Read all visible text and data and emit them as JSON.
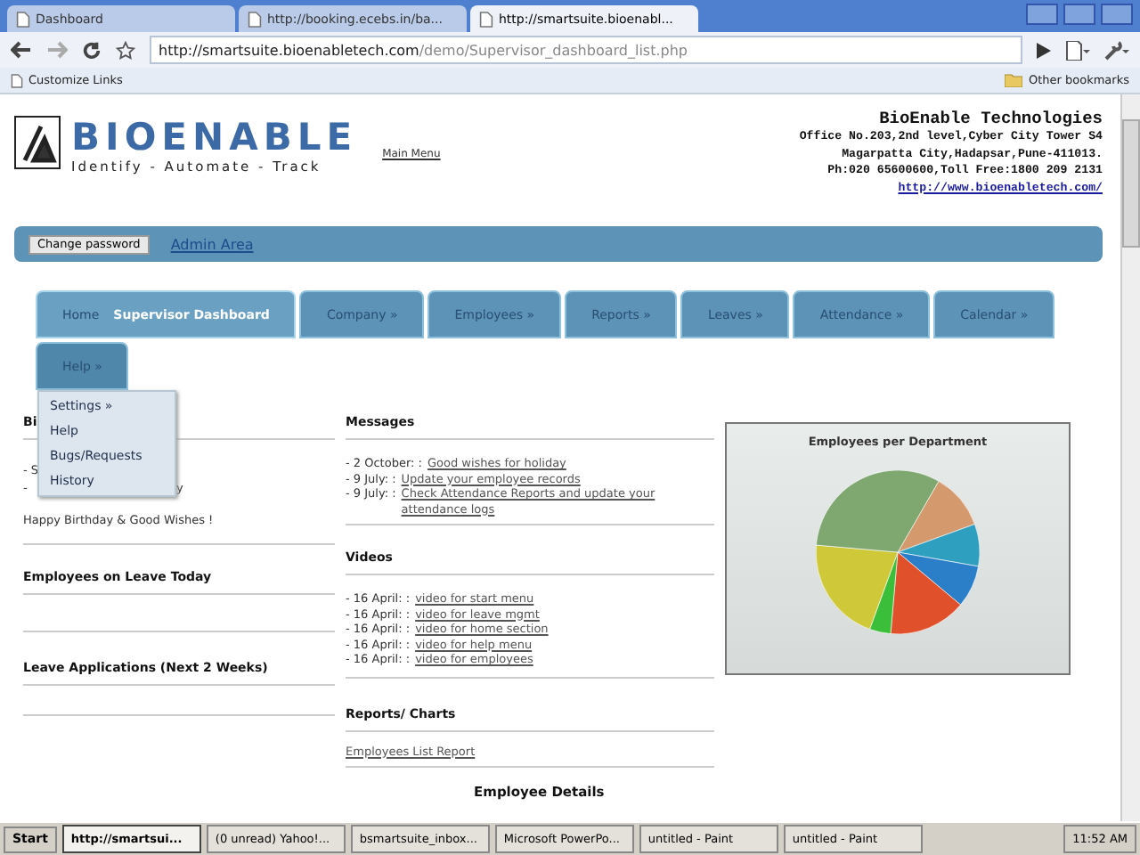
{
  "browser": {
    "tabs": [
      {
        "label": "Dashboard",
        "selected": false
      },
      {
        "label": "http://booking.ecebs.in/ba...",
        "selected": false
      },
      {
        "label": "http://smartsuite.bioenabl...",
        "selected": true
      }
    ],
    "address": {
      "host": "http://smartsuite.bioenabletech.com",
      "path": "/demo/Supervisor_dashboard_list.php"
    },
    "bookmarks": [
      {
        "label": "Customize Links"
      }
    ],
    "other_bookmarks": "Other bookmarks"
  },
  "header": {
    "brand": "BIOENABLE",
    "tagline": "Identify - Automate - Track",
    "main_menu": "Main Menu",
    "company": "BioEnable Technologies",
    "address_lines": [
      "Office No.203,2nd level,Cyber City Tower S4",
      "Magarpatta City,Hadapsar,Pune-411013.",
      "Ph:020 65600600,Toll Free:1800 209 2131"
    ],
    "website": "http://www.bioenabletech.com/"
  },
  "admin_bar": {
    "button": "Change password",
    "title": "Admin Area"
  },
  "nav": {
    "tabs": [
      {
        "label": "Home",
        "current": "Supervisor Dashboard",
        "selected": true
      },
      {
        "label": "Company »",
        "selected": false
      },
      {
        "label": "Employees »",
        "selected": false
      },
      {
        "label": "Reports »",
        "selected": false
      },
      {
        "label": "Leaves »",
        "selected": false
      },
      {
        "label": "Attendance »",
        "selected": false
      },
      {
        "label": "Calendar »",
        "selected": false
      },
      {
        "label": "Help »",
        "selected": false,
        "expanded": true
      }
    ],
    "menu": [
      "Settings »",
      "Help",
      "Bugs/Requests",
      "History"
    ]
  },
  "birthdays": {
    "title": "Bi",
    "lines": [
      {
        "start": "- S"
      },
      {
        "start": "-",
        "end": "y"
      }
    ],
    "wish": "Happy Birthday & Good Wishes !"
  },
  "messages": {
    "title": "Messages",
    "items": [
      {
        "date": "- 2 October: :",
        "link": "Good wishes for holiday"
      },
      {
        "date": "- 9 July: :",
        "link": "Update your employee records"
      },
      {
        "date": "- 9 July: :",
        "link": "Check Attendance Reports and update your attendance logs"
      }
    ]
  },
  "leave_today": {
    "title": "Employees on Leave Today"
  },
  "videos": {
    "title": "Videos",
    "items": [
      {
        "date": "- 16 April: :",
        "link": "video for start menu"
      },
      {
        "date": "- 16 April: :",
        "link": "video for leave mgmt"
      },
      {
        "date": "- 16 April: :",
        "link": "video for home section"
      },
      {
        "date": "- 16 April: :",
        "link": "video for help menu"
      },
      {
        "date": "- 16 April: :",
        "link": "video for employees"
      }
    ]
  },
  "leave_applications": {
    "title": "Leave Applications (Next 2 Weeks)"
  },
  "reports": {
    "title": "Reports/ Charts",
    "link": "Employees List Report"
  },
  "chart": {
    "title": "Employees per Department"
  },
  "employee_details": {
    "title": "Employee Details"
  },
  "taskbar": {
    "start": "Start",
    "items": [
      {
        "label": "http://smartsui...",
        "selected": true
      },
      {
        "label": "(0 unread) Yahoo!...",
        "selected": false
      },
      {
        "label": "bsmartsuite_inbox...",
        "selected": false
      },
      {
        "label": "Microsoft PowerPo...",
        "selected": false
      },
      {
        "label": "untitled - Paint",
        "selected": false
      },
      {
        "label": "untitled - Paint",
        "selected": false
      }
    ],
    "clock": "11:52 AM"
  }
}
